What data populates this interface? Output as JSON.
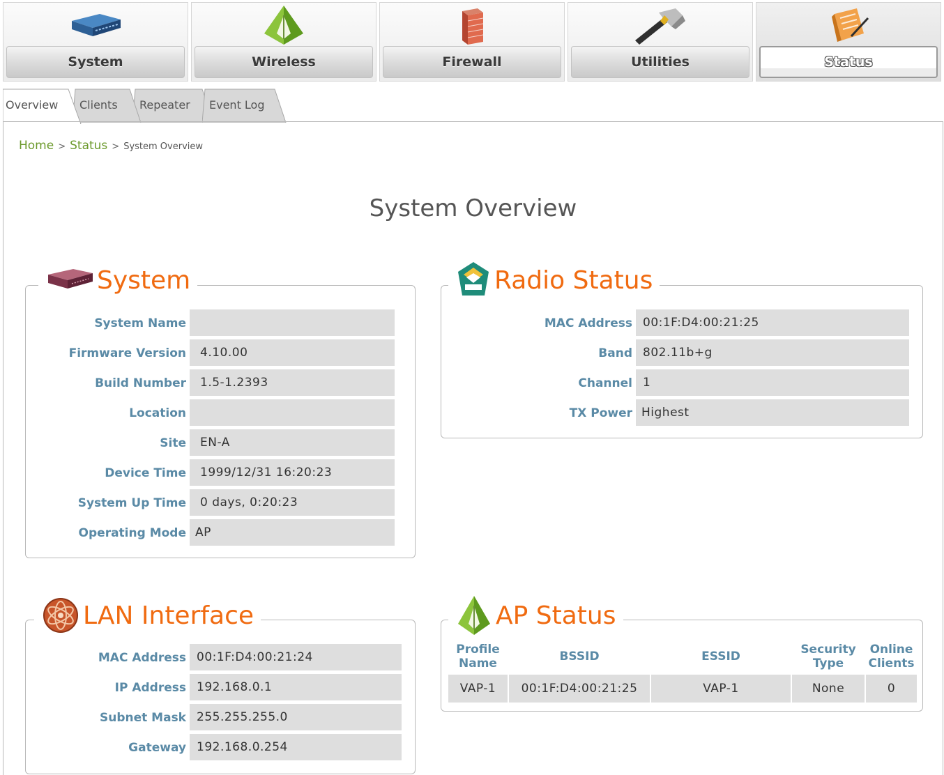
{
  "nav": {
    "items": [
      {
        "label": "System",
        "icon": "router-icon"
      },
      {
        "label": "Wireless",
        "icon": "wireless-icon"
      },
      {
        "label": "Firewall",
        "icon": "firewall-icon"
      },
      {
        "label": "Utilities",
        "icon": "hammer-icon"
      },
      {
        "label": "Status",
        "icon": "status-icon"
      }
    ],
    "active": "Status"
  },
  "subtabs": [
    "Overview",
    "Clients",
    "Repeater",
    "Event Log"
  ],
  "breadcrumb": {
    "home": "Home",
    "status": "Status",
    "current": "System Overview",
    "separator": ">"
  },
  "page_title": "System Overview",
  "system": {
    "title": "System",
    "rows": [
      {
        "label": "System Name",
        "value": ""
      },
      {
        "label": "Firmware Version",
        "value": "4.10.00"
      },
      {
        "label": "Build Number",
        "value": "1.5-1.2393"
      },
      {
        "label": "Location",
        "value": ""
      },
      {
        "label": "Site",
        "value": "EN-A"
      },
      {
        "label": "Device Time",
        "value": "1999/12/31 16:20:23"
      },
      {
        "label": "System Up Time",
        "value": "0 days, 0:20:23"
      },
      {
        "label": "Operating Mode",
        "value": "AP"
      }
    ]
  },
  "radio": {
    "title": "Radio Status",
    "rows": [
      {
        "label": "MAC Address",
        "value": "00:1F:D4:00:21:25"
      },
      {
        "label": "Band",
        "value": "802.11b+g"
      },
      {
        "label": "Channel",
        "value": "1"
      },
      {
        "label": "TX Power",
        "value": "Highest"
      }
    ]
  },
  "lan": {
    "title": "LAN Interface",
    "rows": [
      {
        "label": "MAC Address",
        "value": "00:1F:D4:00:21:24"
      },
      {
        "label": "IP Address",
        "value": "192.168.0.1"
      },
      {
        "label": "Subnet Mask",
        "value": "255.255.255.0"
      },
      {
        "label": "Gateway",
        "value": "192.168.0.254"
      }
    ]
  },
  "ap": {
    "title": "AP Status",
    "headers": [
      "Profile\nName",
      "BSSID",
      "ESSID",
      "Security\nType",
      "Online\nClients"
    ],
    "rows": [
      [
        "VAP-1",
        "00:1F:D4:00:21:25",
        "VAP-1",
        "None",
        "0"
      ]
    ]
  },
  "colors": {
    "accent": "#f06b11",
    "label": "#5a8aa6",
    "link": "#6c9a2c",
    "cell": "#dedede"
  }
}
